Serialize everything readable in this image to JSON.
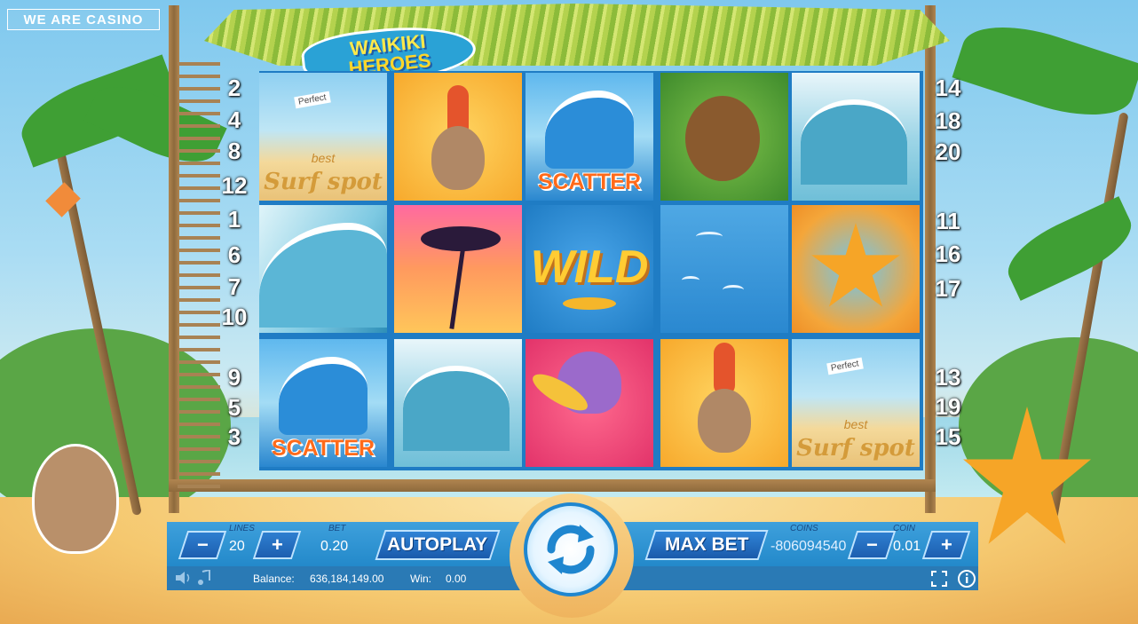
{
  "brand": {
    "logo_text": "WE ARE CASINO"
  },
  "game": {
    "title_line1": "WAIKIKI",
    "title_line2": "HEROES"
  },
  "paylines": {
    "left": [
      "2",
      "4",
      "8",
      "12",
      "1",
      "6",
      "7",
      "10",
      "9",
      "5",
      "3"
    ],
    "right": [
      "14",
      "18",
      "20",
      "11",
      "16",
      "17",
      "13",
      "19",
      "15"
    ]
  },
  "reels": {
    "row1": [
      {
        "symbol": "best-surf-spot-crowd",
        "text": "Surf spot",
        "subtext": "best",
        "sign": "Perfect"
      },
      {
        "symbol": "egg-chick-surfer",
        "text": ""
      },
      {
        "symbol": "scatter-wave",
        "text": "SCATTER"
      },
      {
        "symbol": "coconut-character",
        "text": ""
      },
      {
        "symbol": "surfer-wave",
        "text": ""
      }
    ],
    "row2": [
      {
        "symbol": "big-wave",
        "text": ""
      },
      {
        "symbol": "palm-sunset",
        "text": ""
      },
      {
        "symbol": "wild",
        "text": "WILD"
      },
      {
        "symbol": "seagulls",
        "text": ""
      },
      {
        "symbol": "starfish-character",
        "text": ""
      }
    ],
    "row3": [
      {
        "symbol": "scatter-wave",
        "text": "SCATTER"
      },
      {
        "symbol": "surfer-wave",
        "text": ""
      },
      {
        "symbol": "octopus-character",
        "text": ""
      },
      {
        "symbol": "egg-chick-surfer",
        "text": ""
      },
      {
        "symbol": "best-surf-spot-crowd",
        "text": "Surf spot",
        "subtext": "best",
        "sign": "Perfect"
      }
    ]
  },
  "controls": {
    "lines_caption": "LINES",
    "lines_value": "20",
    "bet_caption": "BET",
    "bet_value": "0.20",
    "autoplay_label": "AUTOPLAY",
    "max_bet_label": "MAX BET",
    "coins_caption": "COINS",
    "coins_value": "-806094540",
    "coin_caption": "COIN",
    "coin_value": "0.01",
    "minus": "−",
    "plus": "+"
  },
  "status": {
    "balance_label": "Balance:",
    "balance_value": "636,184,149.00",
    "win_label": "Win:",
    "win_value": "0.00"
  },
  "icons": [
    "sound-icon",
    "music-icon",
    "fullscreen-icon",
    "info-icon",
    "spin-icon"
  ]
}
